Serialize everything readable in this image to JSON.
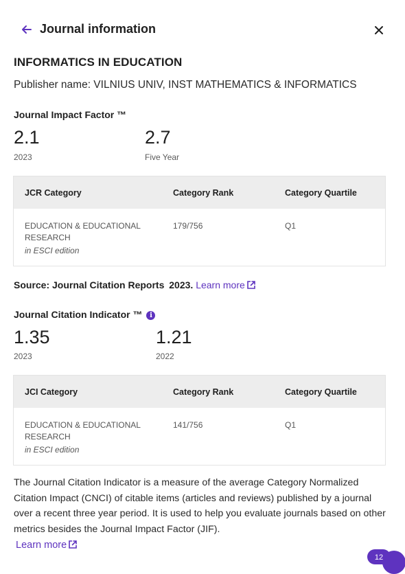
{
  "header": {
    "title": "Journal information"
  },
  "journal": {
    "name": "INFORMATICS IN EDUCATION",
    "publisher": "Publisher name: VILNIUS UNIV, INST MATHEMATICS & INFORMATICS"
  },
  "jif": {
    "label": "Journal Impact Factor ™",
    "current_value": "2.1",
    "current_sub": "2023",
    "five_year_value": "2.7",
    "five_year_sub": "Five Year",
    "table": {
      "headers": [
        "JCR Category",
        "Category Rank",
        "Category Quartile"
      ],
      "rows": [
        {
          "category": "EDUCATION & EDUCATIONAL RESEARCH",
          "edition": "in ESCI edition",
          "rank": "179/756",
          "quartile": "Q1"
        }
      ]
    }
  },
  "source": {
    "label": "Source: Journal Citation Reports",
    "year": "2023.",
    "link": "Learn more"
  },
  "jci": {
    "label": "Journal Citation Indicator ™",
    "current_value": "1.35",
    "current_sub": "2023",
    "prev_value": "1.21",
    "prev_sub": "2022",
    "table": {
      "headers": [
        "JCI Category",
        "Category Rank",
        "Category Quartile"
      ],
      "rows": [
        {
          "category": "EDUCATION & EDUCATIONAL RESEARCH",
          "edition": "in ESCI edition",
          "rank": "141/756",
          "quartile": "Q1"
        }
      ]
    }
  },
  "description": "The Journal Citation Indicator is a measure of the average Category Normalized Citation Impact (CNCI) of citable items (articles and reviews) published by a journal over a recent three year period. It is used to help you evaluate journals based on other metrics besides the Journal Impact Factor (JIF).",
  "learn_more_2": "Learn more",
  "badge": {
    "count": "12"
  },
  "icons": {
    "back": "arrow-left-icon",
    "close": "close-icon",
    "external": "external-link-icon",
    "info": "info-icon"
  },
  "colors": {
    "accent": "#5e33bf",
    "table_header_bg": "#ededed"
  }
}
